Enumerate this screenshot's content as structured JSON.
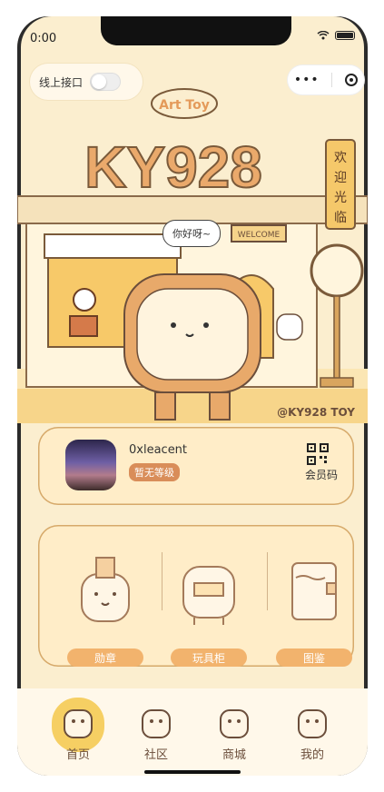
{
  "status": {
    "time": "0:00"
  },
  "header": {
    "toggle_label": "线上接口"
  },
  "scene": {
    "badge_text": "Art Toy",
    "brand_text": "KY928",
    "welcome_sign": "WELCOME",
    "vertical_sign": "欢迎光临",
    "speech": "你好呀~",
    "watermark": "@KY928 TOY"
  },
  "profile": {
    "username": "0xleacent",
    "level": "暂无等级",
    "qr_label": "会员码"
  },
  "features": [
    {
      "label": "勋章"
    },
    {
      "label": "玩具柜"
    },
    {
      "label": "图鉴"
    }
  ],
  "tabs": [
    {
      "label": "首页"
    },
    {
      "label": "社区"
    },
    {
      "label": "商城"
    },
    {
      "label": "我的"
    }
  ]
}
